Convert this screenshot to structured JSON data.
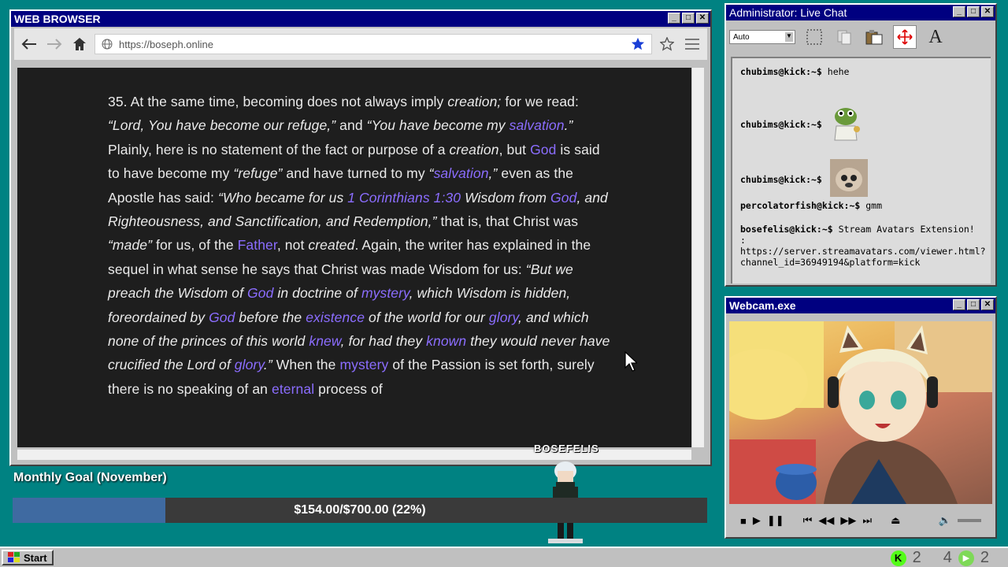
{
  "browser": {
    "title": "WEB BROWSER",
    "url": "https://boseph.online",
    "nav": {
      "back": "←",
      "forward": "→",
      "home": "⌂"
    },
    "article": {
      "segments": [
        {
          "t": "35. At the same time, becoming does not always imply ",
          "s": "n"
        },
        {
          "t": "creation;",
          "s": "i"
        },
        {
          "t": " for we read: ",
          "s": "n"
        },
        {
          "t": "“Lord, You have become our refuge,”",
          "s": "i"
        },
        {
          "t": " and ",
          "s": "n"
        },
        {
          "t": "“You have become my ",
          "s": "i"
        },
        {
          "t": "salvation",
          "s": "il"
        },
        {
          "t": ".”",
          "s": "i"
        },
        {
          "t": " Plainly, here is no statement of the fact or purpose of a ",
          "s": "n"
        },
        {
          "t": "creation",
          "s": "i"
        },
        {
          "t": ", but ",
          "s": "n"
        },
        {
          "t": "God",
          "s": "l"
        },
        {
          "t": " is said to have become my ",
          "s": "n"
        },
        {
          "t": "“refuge”",
          "s": "i"
        },
        {
          "t": " and have turned to my ",
          "s": "n"
        },
        {
          "t": "“",
          "s": "i"
        },
        {
          "t": "salvation",
          "s": "il"
        },
        {
          "t": ",”",
          "s": "i"
        },
        {
          "t": " even as the Apostle has said: ",
          "s": "n"
        },
        {
          "t": "“Who became for us ",
          "s": "i"
        },
        {
          "t": "1 Corinthians 1:30",
          "s": "il"
        },
        {
          "t": " Wisdom from ",
          "s": "i"
        },
        {
          "t": "God",
          "s": "il"
        },
        {
          "t": ", and Righteousness, and Sanctification, and Redemption,”",
          "s": "i"
        },
        {
          "t": " that is, that Christ was ",
          "s": "n"
        },
        {
          "t": "“made”",
          "s": "i"
        },
        {
          "t": " for us, of the ",
          "s": "n"
        },
        {
          "t": "Father",
          "s": "l"
        },
        {
          "t": ", not ",
          "s": "n"
        },
        {
          "t": "created",
          "s": "i"
        },
        {
          "t": ". Again, the writer has explained in the sequel in what sense he says that Christ was made Wisdom for us: ",
          "s": "n"
        },
        {
          "t": "“But we preach the Wisdom of ",
          "s": "i"
        },
        {
          "t": "God",
          "s": "il"
        },
        {
          "t": " in doctrine of ",
          "s": "i"
        },
        {
          "t": "mystery",
          "s": "il"
        },
        {
          "t": ", which Wisdom is hidden, foreordained by ",
          "s": "i"
        },
        {
          "t": "God",
          "s": "il"
        },
        {
          "t": " before the ",
          "s": "i"
        },
        {
          "t": "existence",
          "s": "il"
        },
        {
          "t": " of the world for our ",
          "s": "i"
        },
        {
          "t": "glory",
          "s": "il"
        },
        {
          "t": ", and which none of the princes of this world ",
          "s": "i"
        },
        {
          "t": "knew",
          "s": "il"
        },
        {
          "t": ", for had they ",
          "s": "i"
        },
        {
          "t": "known",
          "s": "il"
        },
        {
          "t": " they would never have crucified the Lord of ",
          "s": "i"
        },
        {
          "t": "glory",
          "s": "il"
        },
        {
          "t": ".”",
          "s": "i"
        },
        {
          "t": " When the ",
          "s": "n"
        },
        {
          "t": "mystery",
          "s": "l"
        },
        {
          "t": " of the Passion is set forth, surely there is no speaking of an ",
          "s": "n"
        },
        {
          "t": "eternal",
          "s": "l"
        },
        {
          "t": " process of",
          "s": "n"
        }
      ]
    }
  },
  "chat": {
    "title": "Administrator: Live Chat",
    "select_value": "Auto",
    "messages": [
      {
        "user": "chubims@kick:~$",
        "text": "hehe"
      },
      {
        "user": "chubims@kick:~$",
        "text": "",
        "emote": "frog-emote"
      },
      {
        "user": "chubims@kick:~$",
        "text": "",
        "emote": "dog-emote"
      },
      {
        "user": "percolatorfish@kick:~$",
        "text": "gmm"
      },
      {
        "user": "bosefelis@kick:~$",
        "text": "Stream Avatars Extension! : https://server.streamavatars.com/viewer.html?channel_id=36949194&platform=kick"
      }
    ]
  },
  "webcam": {
    "title": "Webcam.exe"
  },
  "goal": {
    "label": "Monthly Goal (November)",
    "text": "$154.00/$700.00 (22%)",
    "progress": 0.22
  },
  "avatar_name": "BOSEFELIS",
  "taskbar": {
    "start": "Start",
    "tray": [
      "2",
      "4",
      "2"
    ]
  },
  "colors": {
    "titlebar": "#000080",
    "link": "#8b6dff",
    "goal_fill": "#3f6aa1"
  }
}
